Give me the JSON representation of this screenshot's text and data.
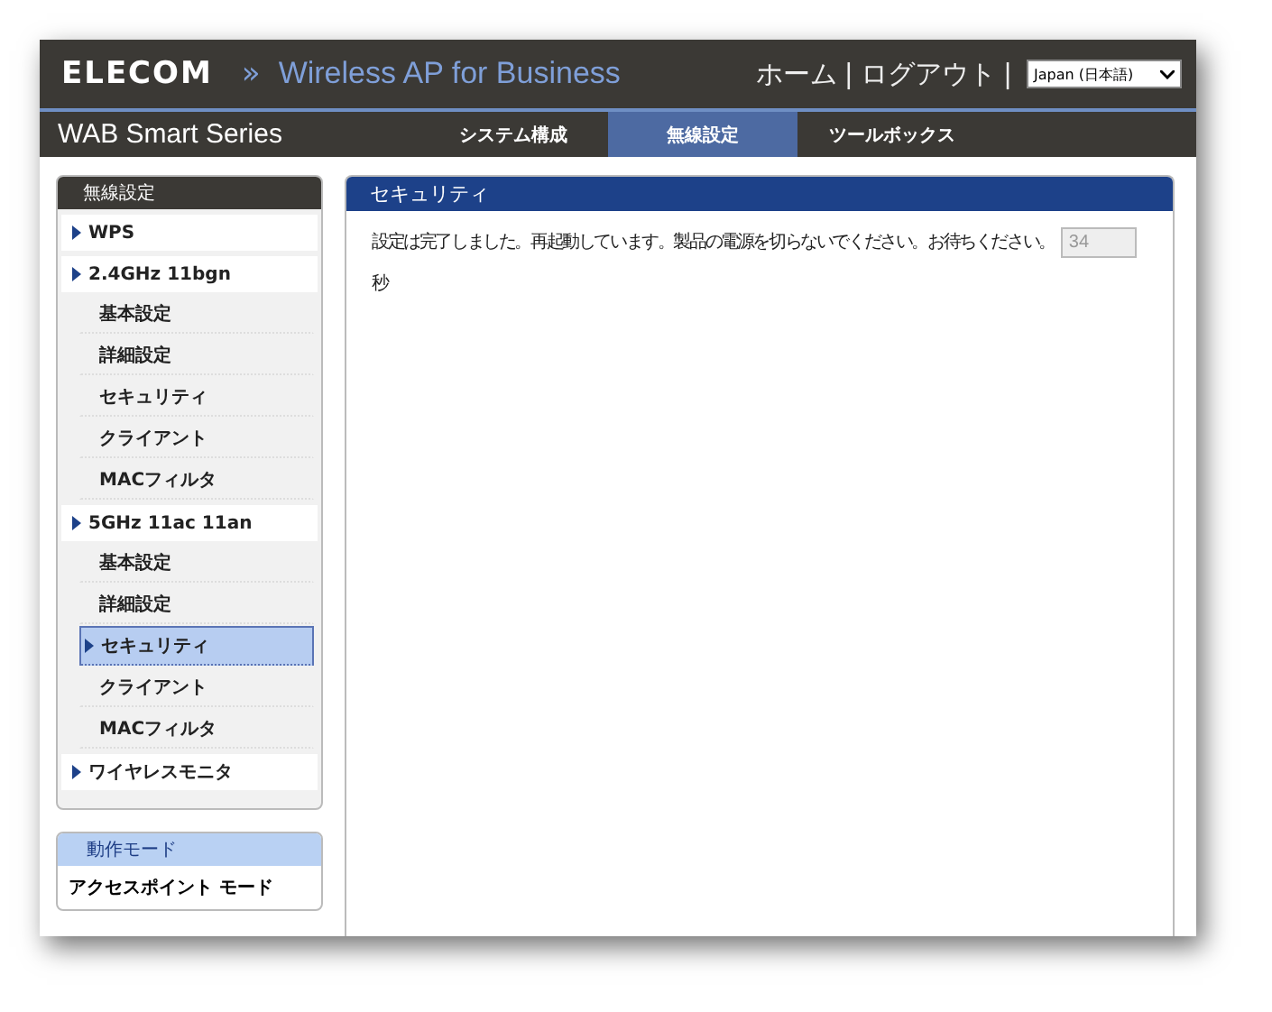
{
  "header": {
    "logo": "ELECOM",
    "chevron": "»",
    "product": "Wireless AP for Business",
    "links": [
      "ホーム",
      "ログアウト"
    ],
    "separator": "|",
    "language": "Japan (日本語)"
  },
  "nav": {
    "brand": "WAB Smart Series",
    "tabs": [
      {
        "label": "システム構成",
        "selected": false
      },
      {
        "label": "無線設定",
        "selected": true
      },
      {
        "label": "ツールボックス",
        "selected": false
      }
    ]
  },
  "sidebar": {
    "title": "無線設定",
    "groups": [
      {
        "label": "WPS"
      },
      {
        "label": "2.4GHz 11bgn",
        "children": [
          {
            "label": "基本設定",
            "selected": false
          },
          {
            "label": "詳細設定",
            "selected": false
          },
          {
            "label": "セキュリティ",
            "selected": false
          },
          {
            "label": "クライアント",
            "selected": false
          },
          {
            "label": "MACフィルタ",
            "selected": false
          }
        ]
      },
      {
        "label": "5GHz 11ac 11an",
        "children": [
          {
            "label": "基本設定",
            "selected": false
          },
          {
            "label": "詳細設定",
            "selected": false
          },
          {
            "label": "セキュリティ",
            "selected": true
          },
          {
            "label": "クライアント",
            "selected": false
          },
          {
            "label": "MACフィルタ",
            "selected": false
          }
        ]
      },
      {
        "label": "ワイヤレスモニタ"
      }
    ]
  },
  "mode": {
    "title": "動作モード",
    "value": "アクセスポイント モード"
  },
  "main": {
    "title": "セキュリティ",
    "message": "設定は完了しました。再起動しています。製品の電源を切らないでください。お待ちください。",
    "countdown": "34",
    "unit": "秒"
  }
}
